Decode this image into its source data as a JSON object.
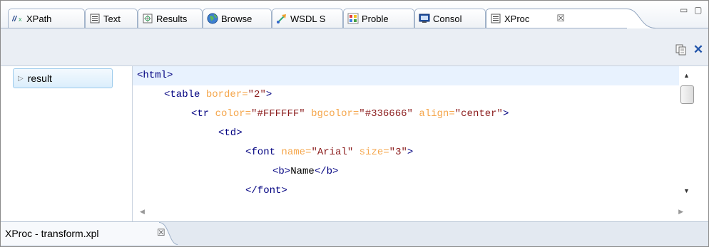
{
  "tabs": [
    {
      "label": "XPath",
      "icon": "xpath-icon"
    },
    {
      "label": "Text",
      "icon": "text-icon"
    },
    {
      "label": "Results",
      "icon": "results-icon"
    },
    {
      "label": "Browse",
      "icon": "globe-icon"
    },
    {
      "label": "WSDL S",
      "icon": "wsdl-icon"
    },
    {
      "label": "Proble",
      "icon": "problems-icon"
    },
    {
      "label": "Consol",
      "icon": "console-icon"
    },
    {
      "label": "XProc",
      "icon": "xproc-icon",
      "active": true,
      "close": "☒"
    }
  ],
  "window_controls": {
    "minimize": "▭",
    "maximize": "▢"
  },
  "toolbar": {
    "copy_icon": "copy-icon",
    "close_icon": "close-icon",
    "close_glyph": "✕"
  },
  "tree": {
    "items": [
      {
        "label": "result",
        "expander": "▷"
      }
    ]
  },
  "editor": {
    "lines": [
      {
        "tag_open": "<html>"
      },
      {
        "tag_open": "<table",
        "attrs": [
          {
            "name": "border",
            "value": "\"2\""
          }
        ],
        "tag_close": ">"
      },
      {
        "tag_open": "<tr",
        "attrs": [
          {
            "name": "color",
            "value": "\"#FFFFFF\""
          },
          {
            "name": "bgcolor",
            "value": "\"#336666\""
          },
          {
            "name": "align",
            "value": "\"center\""
          }
        ],
        "tag_close": ">"
      },
      {
        "tag_open": "<td>"
      },
      {
        "tag_open": "<font",
        "attrs": [
          {
            "name": "name",
            "value": "\"Arial\""
          },
          {
            "name": "size",
            "value": "\"3\""
          }
        ],
        "tag_close": ">"
      },
      {
        "tag_open": "<b>",
        "text": "Name",
        "tag_end": "</b>"
      },
      {
        "tag_open": "</font>"
      }
    ]
  },
  "scroll": {
    "up": "▲",
    "down": "▼",
    "left": "◀",
    "right": "▶"
  },
  "bottom_tab": {
    "label": "XProc - transform.xpl",
    "close": "☒"
  },
  "colors": {
    "tag": "#000080",
    "attr": "#f5a64b",
    "value": "#8b1c1c",
    "current_line": "#e8f2fe"
  }
}
